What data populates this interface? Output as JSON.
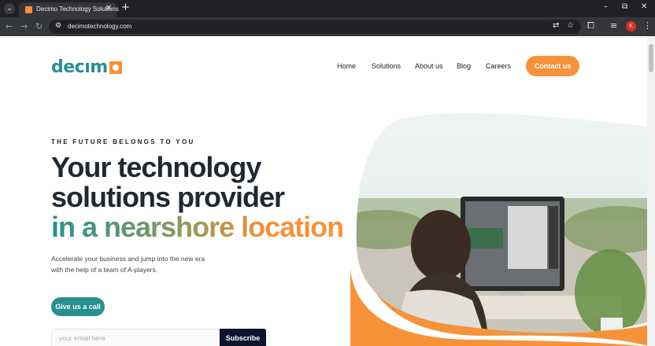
{
  "browser": {
    "tab_title": "Decimo Technology Solutions",
    "url": "decimotechnology.com",
    "avatar_letter": "K"
  },
  "site": {
    "logo_text": "decım",
    "nav": [
      "Home",
      "Solutions",
      "About us",
      "Blog",
      "Careers"
    ],
    "contact_label": "Contact us",
    "accent_orange": "#f6923a",
    "accent_teal": "#2a8f8f"
  },
  "hero": {
    "eyebrow": "THE FUTURE BELONGS TO YOU",
    "title_line1": "Your technology",
    "title_line2": "solutions provider",
    "title_line3": "in a nearshore location",
    "desc_line1": "Accelerate your business and jump into the new era",
    "desc_line2": "with the help of a team of A-players.",
    "call_label": "Give us a call",
    "email_placeholder": "your email here",
    "subscribe_label": "Subscribe"
  }
}
